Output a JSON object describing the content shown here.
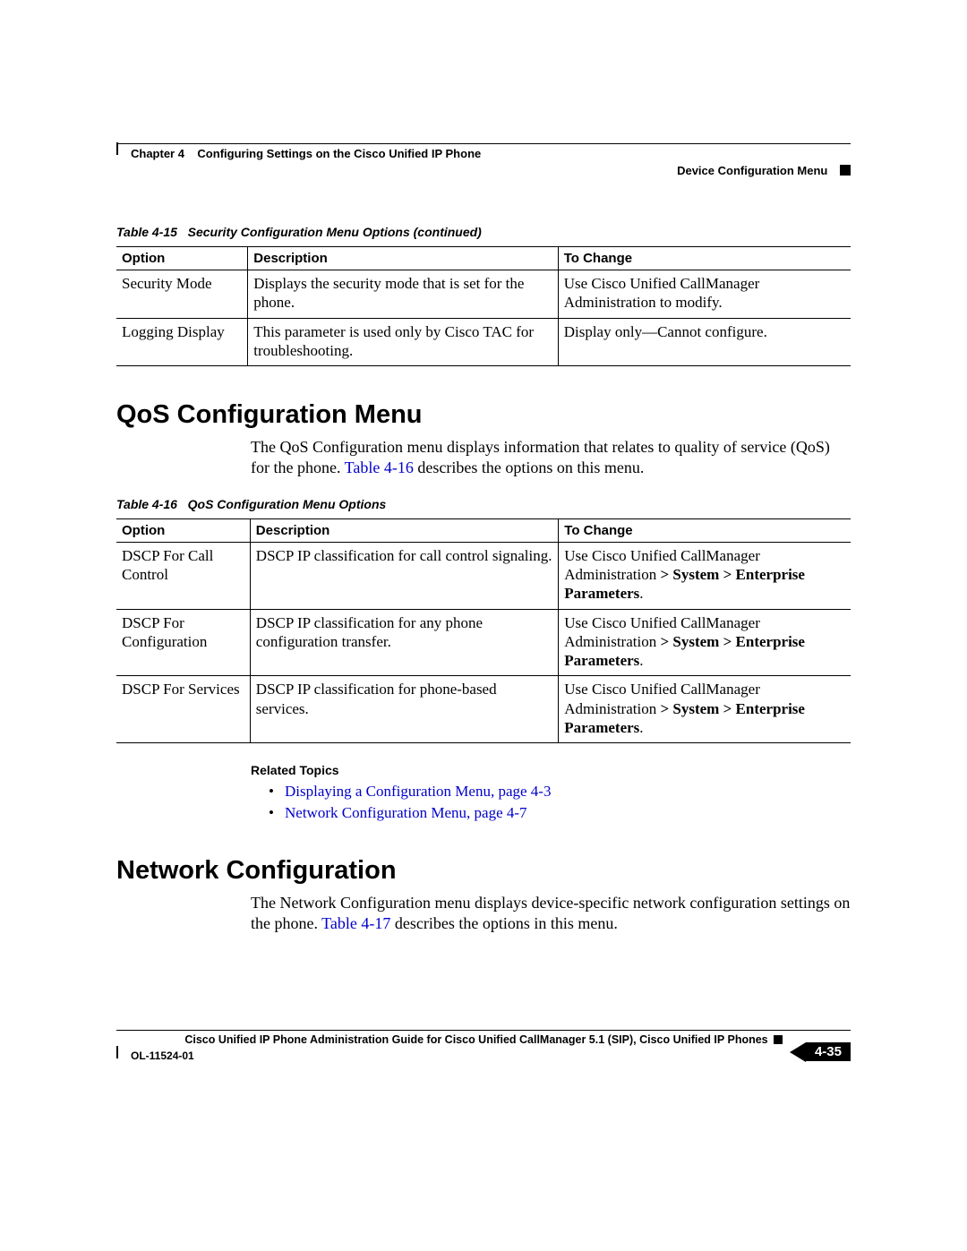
{
  "header": {
    "chapter_label": "Chapter 4",
    "chapter_title": "Configuring Settings on the Cisco Unified IP Phone",
    "section_right": "Device Configuration Menu"
  },
  "table15": {
    "caption_prefix": "Table 4-15",
    "caption": "Security Configuration Menu Options (continued)",
    "headers": [
      "Option",
      "Description",
      "To Change"
    ],
    "rows": [
      {
        "option": "Security Mode",
        "description": "Displays the security mode that is set for the phone.",
        "to_change": "Use Cisco Unified CallManager Administration to modify."
      },
      {
        "option": "Logging Display",
        "description": "This parameter is used only by Cisco TAC for troubleshooting.",
        "to_change": "Display only—Cannot configure."
      }
    ]
  },
  "section_qos": {
    "heading": "QoS Configuration Menu",
    "body_pre": "The QoS Configuration menu displays information that relates to quality of service (QoS) for the phone. ",
    "body_link": "Table 4-16",
    "body_post": " describes the options on this menu."
  },
  "table16": {
    "caption_prefix": "Table 4-16",
    "caption": "QoS Configuration Menu Options",
    "headers": [
      "Option",
      "Description",
      "To Change"
    ],
    "rows": [
      {
        "option": "DSCP For Call Control",
        "description": "DSCP IP classification for call control signaling.",
        "to_change_pre": "Use Cisco Unified CallManager Administration ",
        "to_change_bold": "> System > Enterprise Parameters",
        "to_change_post": "."
      },
      {
        "option": "DSCP For Configuration",
        "description": "DSCP IP classification for any phone configuration transfer.",
        "to_change_pre": "Use Cisco Unified CallManager Administration ",
        "to_change_bold": "> System > Enterprise Parameters",
        "to_change_post": "."
      },
      {
        "option": "DSCP For Services",
        "description": "DSCP IP classification for phone-based services.",
        "to_change_pre": "Use Cisco Unified CallManager Administration ",
        "to_change_bold": "> System > Enterprise Parameters",
        "to_change_post": "."
      }
    ]
  },
  "related": {
    "heading": "Related Topics",
    "items": [
      "Displaying a Configuration Menu, page 4-3",
      "Network Configuration Menu, page 4-7"
    ]
  },
  "section_net": {
    "heading": "Network Configuration",
    "body_pre": "The Network Configuration menu displays device-specific network configuration settings on the phone. ",
    "body_link": "Table 4-17",
    "body_post": " describes the options in this menu."
  },
  "footer": {
    "book_title": "Cisco Unified IP Phone Administration Guide for Cisco Unified CallManager 5.1 (SIP), Cisco Unified IP Phones",
    "doc_id": "OL-11524-01",
    "page_num": "4-35"
  }
}
